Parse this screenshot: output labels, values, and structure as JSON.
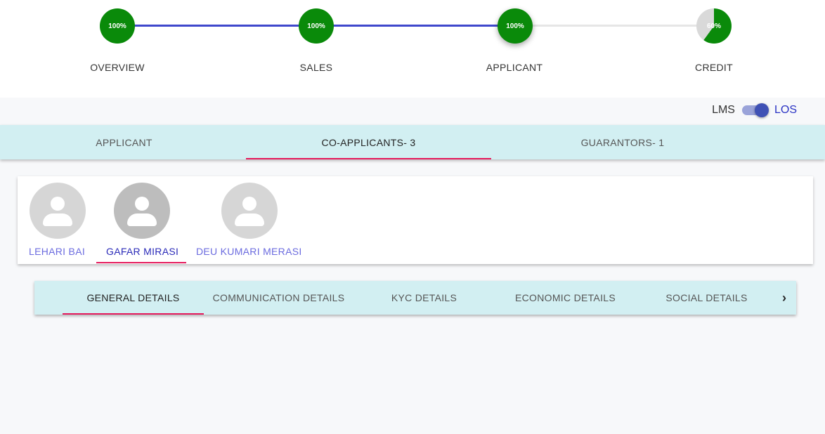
{
  "stepper": {
    "steps": [
      {
        "label": "OVERVIEW",
        "percent_text": "100%",
        "progress": 1.0
      },
      {
        "label": "SALES",
        "percent_text": "100%",
        "progress": 1.0
      },
      {
        "label": "APPLICANT",
        "percent_text": "100%",
        "progress": 1.0
      },
      {
        "label": "CREDIT",
        "percent_text": "60%",
        "progress": 0.6
      }
    ],
    "colors": {
      "done": "#0a8a0a",
      "line_done": "#3f48cc",
      "line_pending": "#e6e6e6",
      "pending_fill": "#d9d9d9"
    }
  },
  "mode_toggle": {
    "left_label": "LMS",
    "right_label": "LOS",
    "selected": "LOS"
  },
  "applicant_tabs": [
    {
      "label": "APPLICANT",
      "active": false
    },
    {
      "label": "CO-APPLICANTS- 3",
      "active": true
    },
    {
      "label": "GUARANTORS- 1",
      "active": false
    }
  ],
  "co_applicants": [
    {
      "name": "LEHARI BAI",
      "active": false
    },
    {
      "name": "GAFAR MIRASI",
      "active": true
    },
    {
      "name": "DEU KUMARI MERASI",
      "active": false
    }
  ],
  "detail_tabs": [
    {
      "label": "GENERAL DETAILS",
      "active": true
    },
    {
      "label": "COMMUNICATION DETAILS",
      "active": false
    },
    {
      "label": "KYC DETAILS",
      "active": false
    },
    {
      "label": "ECONOMIC DETAILS",
      "active": false
    },
    {
      "label": "SOCIAL DETAILS",
      "active": false
    }
  ],
  "scroll_next_icon": "chevron-right-icon",
  "accent_color": "#e5195c"
}
